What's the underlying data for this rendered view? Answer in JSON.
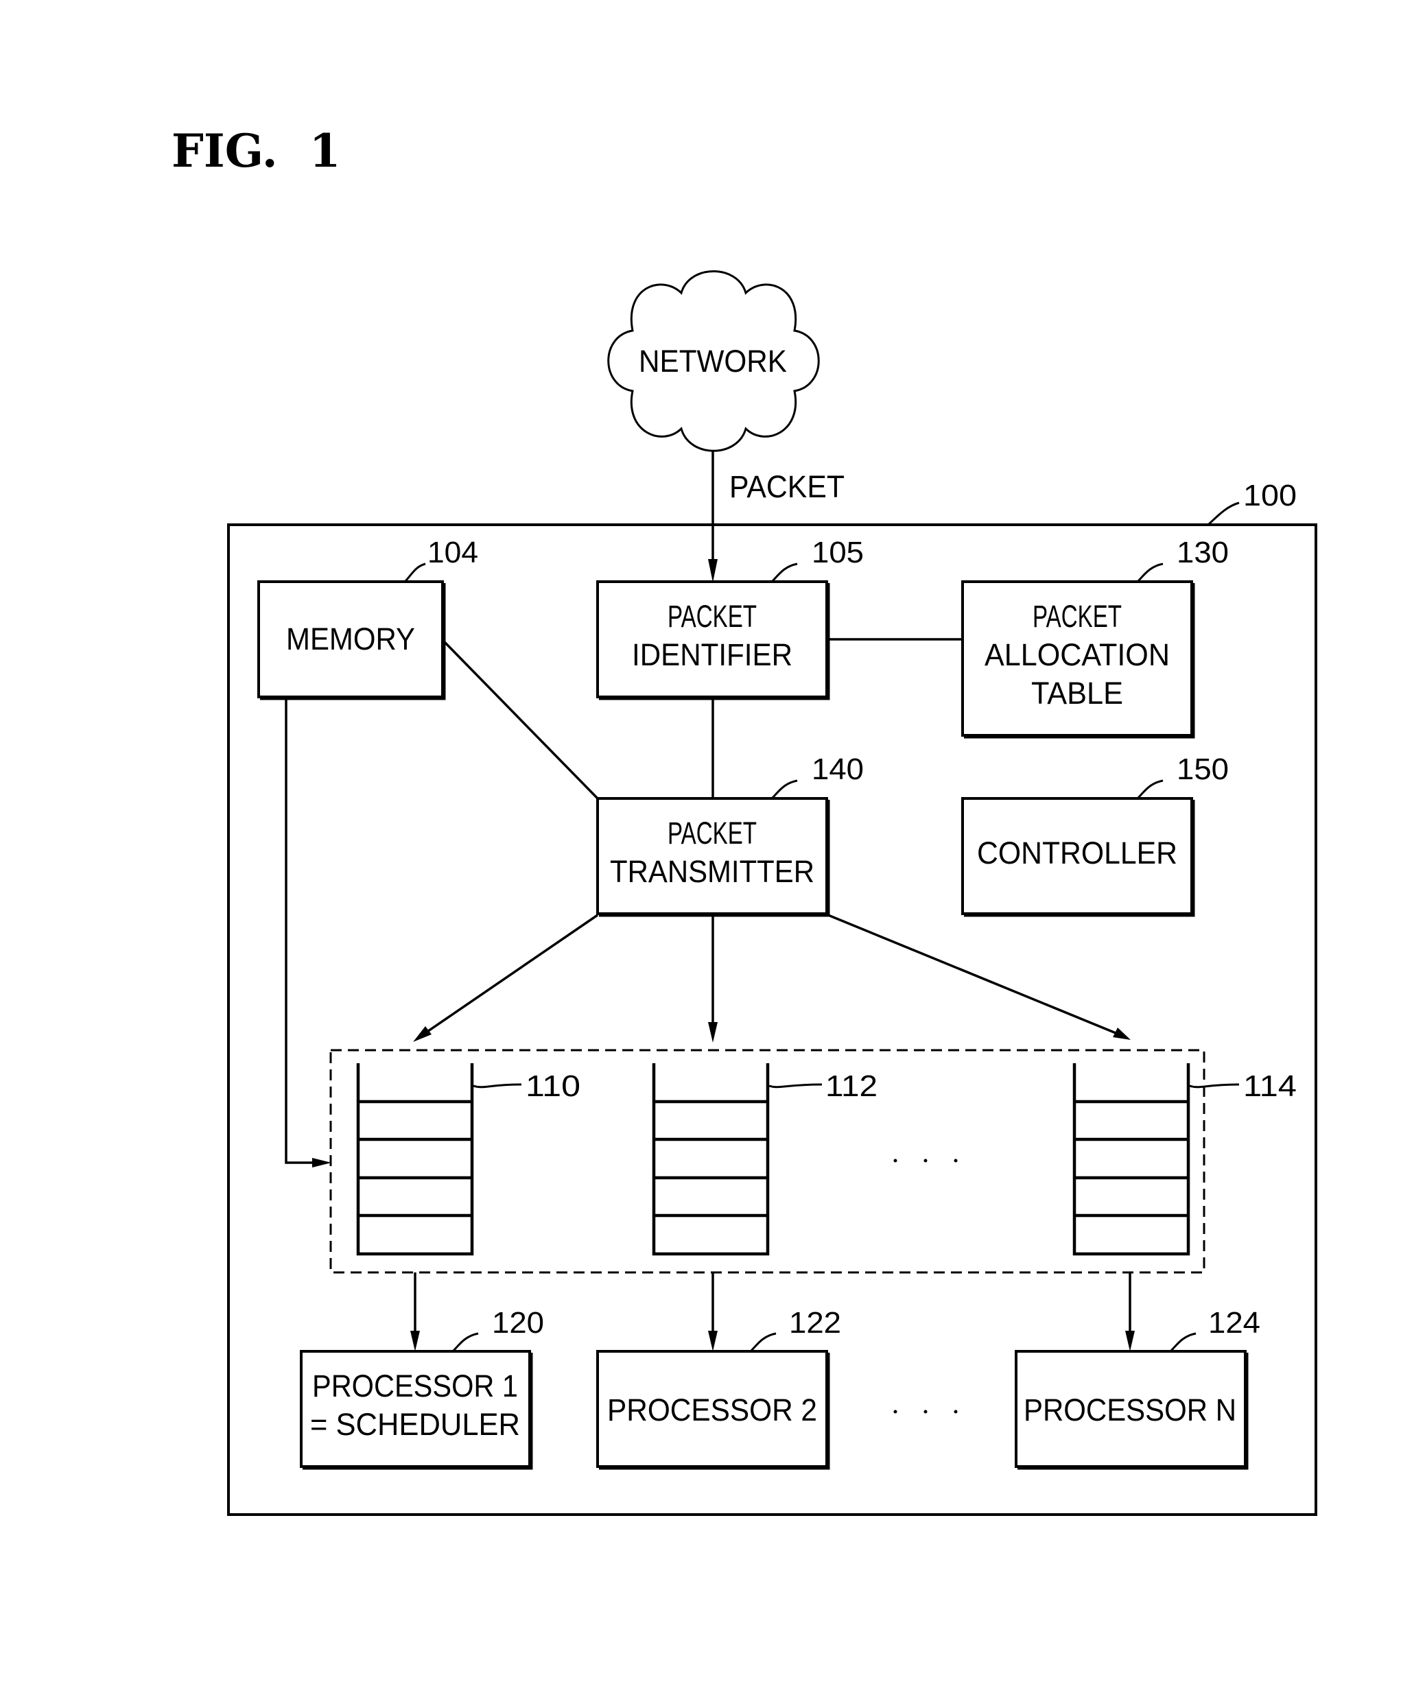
{
  "figure": {
    "title": "FIG.  1"
  },
  "network": {
    "label": "NETWORK",
    "edge_label": "PACKET"
  },
  "device": {
    "ref": "100"
  },
  "blocks": {
    "memory": {
      "ref": "104",
      "lines": [
        "MEMORY"
      ]
    },
    "packet_identifier": {
      "ref": "105",
      "lines": [
        "PACKET",
        "IDENTIFIER"
      ]
    },
    "packet_allocation_table": {
      "ref": "130",
      "lines": [
        "PACKET",
        "ALLOCATION",
        "TABLE"
      ]
    },
    "packet_transmitter": {
      "ref": "140",
      "lines": [
        "PACKET",
        "TRANSMITTER"
      ]
    },
    "controller": {
      "ref": "150",
      "lines": [
        "CONTROLLER"
      ]
    }
  },
  "queues": [
    {
      "ref": "110"
    },
    {
      "ref": "112"
    },
    {
      "ref": "114"
    }
  ],
  "processors": [
    {
      "ref": "120",
      "lines": [
        "PROCESSOR 1",
        "= SCHEDULER"
      ]
    },
    {
      "ref": "122",
      "lines": [
        "PROCESSOR 2"
      ]
    },
    {
      "ref": "124",
      "lines": [
        "PROCESSOR N"
      ]
    }
  ],
  "ellipsis": "· · ·"
}
